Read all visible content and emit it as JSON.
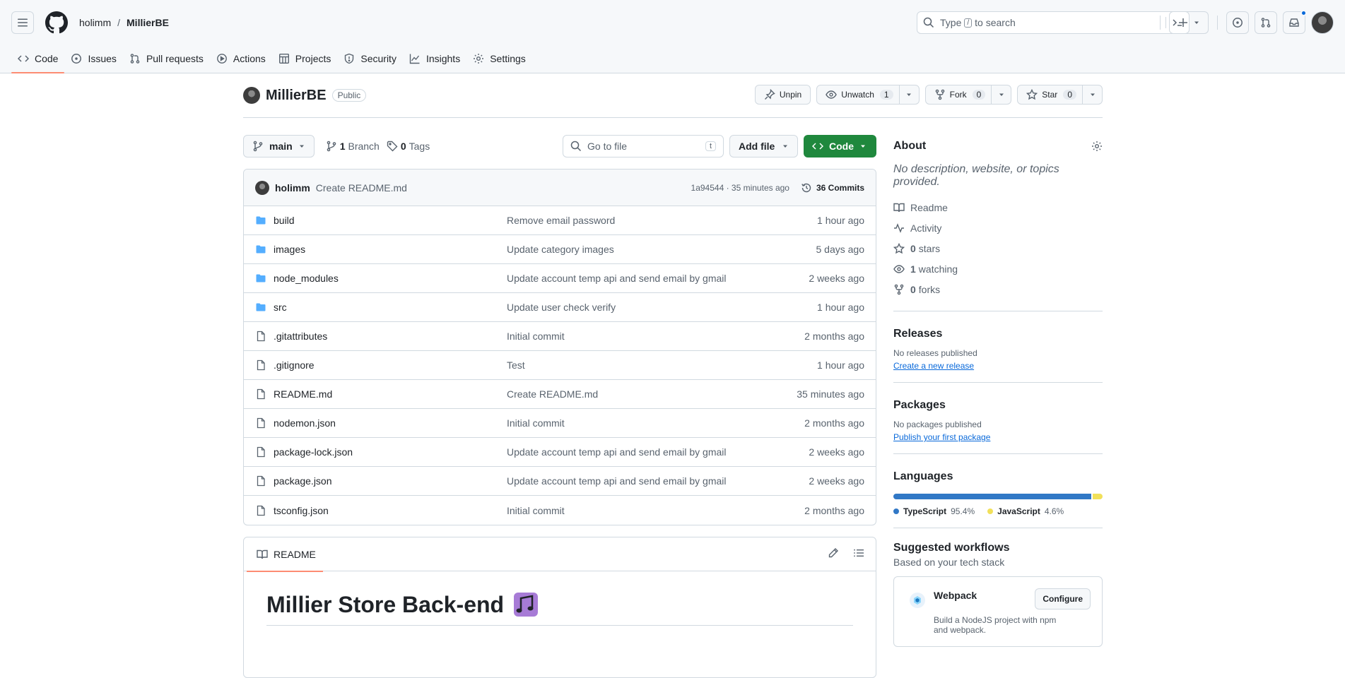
{
  "header": {
    "owner": "holimm",
    "separator": "/",
    "repo": "MillierBE",
    "search": {
      "before": "Type",
      "key": "/",
      "after": "to search"
    }
  },
  "nav": {
    "tabs": [
      {
        "label": "Code",
        "icon": "code-icon"
      },
      {
        "label": "Issues",
        "icon": "issue-icon"
      },
      {
        "label": "Pull requests",
        "icon": "pull-request-icon"
      },
      {
        "label": "Actions",
        "icon": "play-icon"
      },
      {
        "label": "Projects",
        "icon": "table-icon"
      },
      {
        "label": "Security",
        "icon": "shield-icon"
      },
      {
        "label": "Insights",
        "icon": "graph-icon"
      },
      {
        "label": "Settings",
        "icon": "gear-icon"
      }
    ]
  },
  "repo": {
    "name": "MillierBE",
    "visibility": "Public",
    "unpin": "Unpin",
    "unwatch": "Unwatch",
    "watch_count": "1",
    "fork": "Fork",
    "fork_count": "0",
    "star": "Star",
    "star_count": "0"
  },
  "toolbar": {
    "branch": "main",
    "branches_count": "1",
    "branches_label": "Branch",
    "tags_count": "0",
    "tags_label": "Tags",
    "goto_placeholder": "Go to file",
    "goto_key": "t",
    "add_file": "Add file",
    "code": "Code"
  },
  "commit": {
    "author": "holimm",
    "message": "Create README.md",
    "hash_time": "1a94544 · 35 minutes ago",
    "commits_label": "36 Commits"
  },
  "files": [
    {
      "type": "dir",
      "name": "build",
      "message": "Remove email password",
      "age": "1 hour ago"
    },
    {
      "type": "dir",
      "name": "images",
      "message": "Update category images",
      "age": "5 days ago"
    },
    {
      "type": "dir",
      "name": "node_modules",
      "message": "Update account temp api and send email by gmail",
      "age": "2 weeks ago"
    },
    {
      "type": "dir",
      "name": "src",
      "message": "Update user check verify",
      "age": "1 hour ago"
    },
    {
      "type": "file",
      "name": ".gitattributes",
      "message": "Initial commit",
      "age": "2 months ago"
    },
    {
      "type": "file",
      "name": ".gitignore",
      "message": "Test",
      "age": "1 hour ago"
    },
    {
      "type": "file",
      "name": "README.md",
      "message": "Create README.md",
      "age": "35 minutes ago"
    },
    {
      "type": "file",
      "name": "nodemon.json",
      "message": "Initial commit",
      "age": "2 months ago"
    },
    {
      "type": "file",
      "name": "package-lock.json",
      "message": "Update account temp api and send email by gmail",
      "age": "2 weeks ago"
    },
    {
      "type": "file",
      "name": "package.json",
      "message": "Update account temp api and send email by gmail",
      "age": "2 weeks ago"
    },
    {
      "type": "file",
      "name": "tsconfig.json",
      "message": "Initial commit",
      "age": "2 months ago"
    }
  ],
  "readme": {
    "tab": "README",
    "heading": "Millier Store Back-end"
  },
  "about": {
    "title": "About",
    "description": "No description, website, or topics provided.",
    "readme": "Readme",
    "activity": "Activity",
    "stars_count": "0",
    "stars_label": "stars",
    "watching_count": "1",
    "watching_label": "watching",
    "forks_count": "0",
    "forks_label": "forks"
  },
  "releases": {
    "title": "Releases",
    "empty": "No releases published",
    "link": "Create a new release"
  },
  "packages": {
    "title": "Packages",
    "empty": "No packages published",
    "link": "Publish your first package"
  },
  "languages": {
    "title": "Languages",
    "items": [
      {
        "name": "TypeScript",
        "percent": "95.4%",
        "value": 95.4,
        "color": "#3178c6"
      },
      {
        "name": "JavaScript",
        "percent": "4.6%",
        "value": 4.6,
        "color": "#f1e05a"
      }
    ]
  },
  "workflows": {
    "title": "Suggested workflows",
    "subtitle": "Based on your tech stack",
    "card_title": "Webpack",
    "card_desc": "Build a NodeJS project with npm and webpack.",
    "configure": "Configure"
  },
  "colors": {
    "accent": "#fd8c73",
    "primary_button": "#1f883d",
    "link": "#0969da",
    "folder": "#54aeff"
  }
}
